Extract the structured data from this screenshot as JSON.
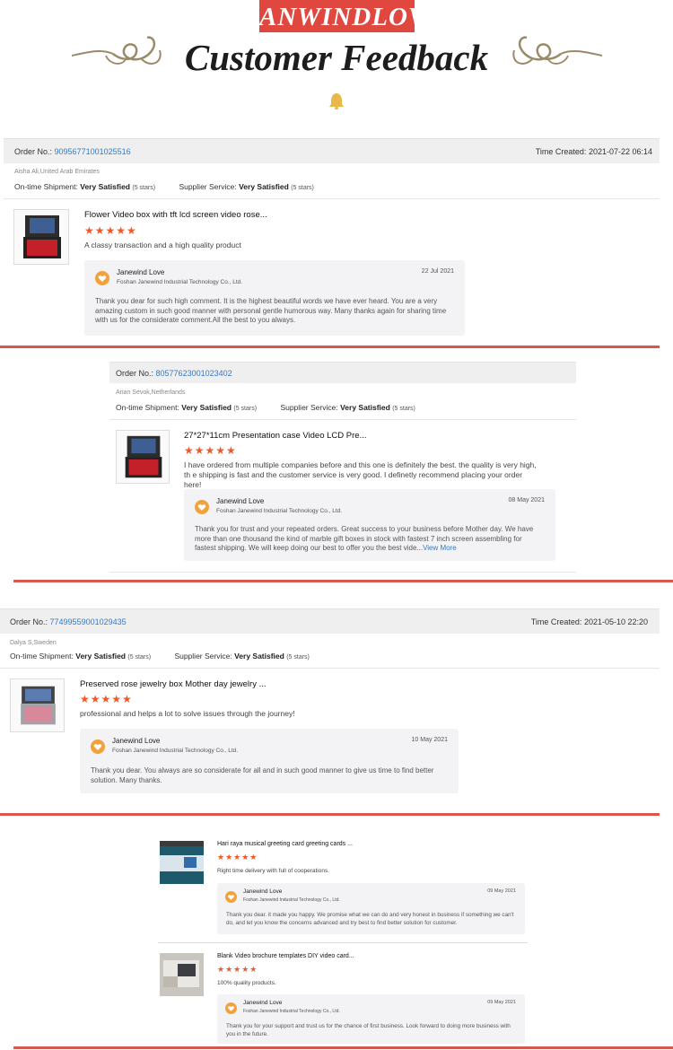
{
  "header": {
    "brand": "ANWINDLOV",
    "title": "Customer Feedback"
  },
  "labels": {
    "order_no": "Order No.:",
    "time_created": "Time Created:",
    "on_time": "On-time Shipment:",
    "supplier": "Supplier Service:",
    "very_satisfied": "Very Satisfied",
    "five_stars": "(5 stars)",
    "stars": "★★★★★",
    "seller_name": "Janewind Love",
    "seller_company": "Foshan Janewind Industrial Technology Co., Ltd."
  },
  "reviews": [
    {
      "order_no": "90956771001025516",
      "time": "2021-07-22 06:14",
      "buyer": "Aisha Ali,United Arab Emirates",
      "product": "Flower Video box with tft lcd screen video rose...",
      "rating": 5,
      "comment": "A classy transaction and a high quality product",
      "reply_date": "22 Jul 2021",
      "reply": "Thank you dear for such high comment. It is the highest beautiful words we have ever heard. You are a very amazing custom in such good manner with personal gentle humorous way. Many thanks again for sharing time with us for the considerate comment.All the best to you always."
    },
    {
      "order_no": "80577623001023402",
      "buyer": "Arian Sevok,Netherlands",
      "product": "27*27*11cm Presentation case Video LCD Pre...",
      "rating": 5,
      "comment": "I have ordered from multiple companies before and this one is definitely the best. the quality is very high, th e shipping is fast and the customer service is very good. I definetly recommend placing your order here!",
      "reply_date": "08 May 2021",
      "reply": "Thank you for trust and your repeated orders. Great success to your business before Mother day. We have more than one thousand the kind of marble gift boxes in stock with fastest 7 inch screen assembling for fastest shipping. We will keep doing our best to offer you the best vide...",
      "view_more": "View More"
    },
    {
      "order_no": "77499559001029435",
      "time": "2021-05-10 22:20",
      "buyer": "Dalya S,Sweden",
      "product": "Preserved rose jewelry box Mother day jewelry ...",
      "rating": 5,
      "comment": "professional and helps a lot to solve issues through the journey!",
      "reply_date": "10 May 2021",
      "reply": "Thank you dear. You always are so considerate for all and in such good manner to give us time to find better solution. Many thanks."
    },
    {
      "product": "Hari raya musical greeting card greeting cards ...",
      "rating": 5,
      "comment": "Right time delivery with full of cooperations.",
      "reply_date": "09 May 2021",
      "reply": "Thank you dear. it made you happy. We promise what we can do and very honest in business if something we can't do,  and let you know the concerns advanced and try best to find better solution for customer."
    },
    {
      "product": "Blank Video brochure templates DIY video card...",
      "rating": 5,
      "comment": "100% quality products.",
      "reply_date": "09 May 2021",
      "reply": "Thank you for your support and trust us for the chance of first business. Look forward to doing more business with you in the future."
    }
  ],
  "colors": {
    "accent": "#e0473f",
    "stars": "#f0582a",
    "link": "#3579c4",
    "bell": "#e8b94a"
  }
}
